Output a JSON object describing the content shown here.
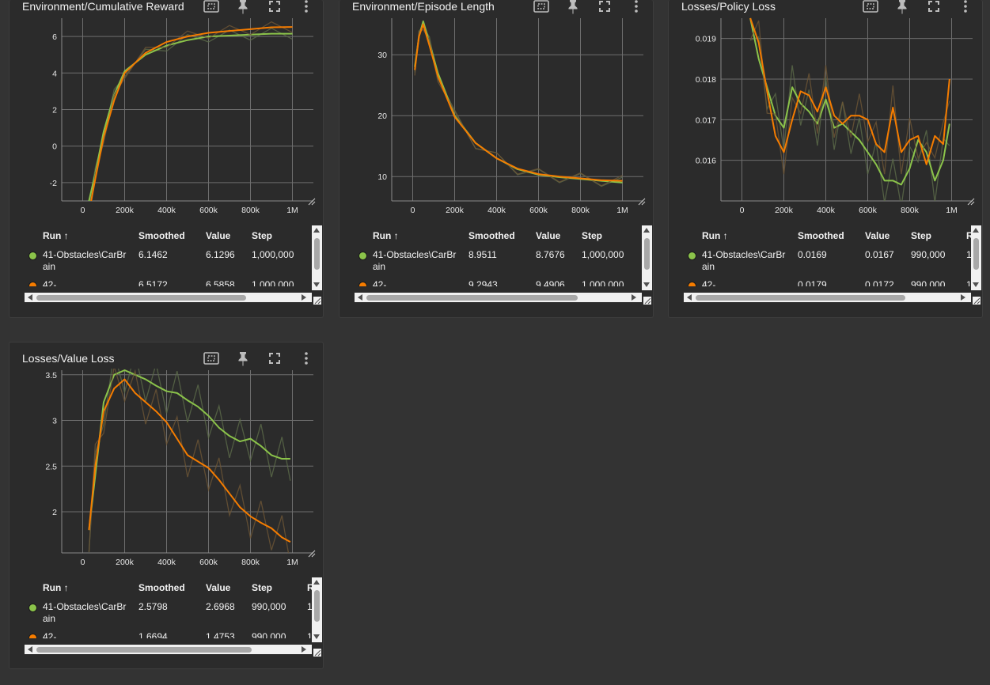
{
  "colors": {
    "green": "#8bc34a",
    "orange": "#f57c00",
    "raw_green": "#5d6b4a",
    "raw_orange": "#6e5636"
  },
  "toolbar_icons": [
    "fit-domain-icon",
    "pin-icon",
    "fullscreen-icon",
    "more-vert-icon"
  ],
  "table_headers": {
    "run": "Run ↑",
    "smoothed": "Smoothed",
    "value": "Value",
    "step": "Step",
    "relative": "R"
  },
  "cards": [
    {
      "title": "Environment/Cumulative Reward",
      "rows": [
        {
          "run": "41-Obstacles\\CarBrain",
          "smoothed": "6.1462",
          "value": "6.1296",
          "step": "1,000,000",
          "relative": ""
        },
        {
          "run": "42-",
          "smoothed": "6.5172",
          "value": "6.5858",
          "step": "1,000,000",
          "relative": ""
        }
      ]
    },
    {
      "title": "Environment/Episode Length",
      "rows": [
        {
          "run": "41-Obstacles\\CarBrain",
          "smoothed": "8.9511",
          "value": "8.7676",
          "step": "1,000,000",
          "relative": ""
        },
        {
          "run": "42-",
          "smoothed": "9.2943",
          "value": "9.4906",
          "step": "1,000,000",
          "relative": ""
        }
      ]
    },
    {
      "title": "Losses/Policy Loss",
      "rows": [
        {
          "run": "41-Obstacles\\CarBrain",
          "smoothed": "0.0169",
          "value": "0.0167",
          "step": "990,000",
          "relative": "1"
        },
        {
          "run": "42-",
          "smoothed": "0.0179",
          "value": "0.0172",
          "step": "990,000",
          "relative": "1"
        }
      ]
    },
    {
      "title": "Losses/Value Loss",
      "rows": [
        {
          "run": "41-Obstacles\\CarBrain",
          "smoothed": "2.5798",
          "value": "2.6968",
          "step": "990,000",
          "relative": "1"
        },
        {
          "run": "42-",
          "smoothed": "1.6694",
          "value": "1.4753",
          "step": "990,000",
          "relative": "1"
        }
      ]
    }
  ],
  "chart_data": [
    {
      "type": "line",
      "title": "Environment/Cumulative Reward",
      "x_ticks": [
        "0",
        "200k",
        "400k",
        "600k",
        "800k",
        "1M"
      ],
      "y_ticks": [
        "6",
        "4",
        "2",
        "0",
        "-2"
      ],
      "xlim": [
        -100000,
        1100000
      ],
      "ylim": [
        -3,
        7
      ],
      "series": [
        {
          "name": "41-Obstacles\\CarBrain",
          "color": "#8bc34a",
          "x": [
            30000,
            60000,
            100000,
            150000,
            200000,
            300000,
            400000,
            500000,
            600000,
            700000,
            800000,
            900000,
            1000000
          ],
          "y": [
            -3,
            -1.5,
            0.8,
            2.8,
            4.1,
            5.0,
            5.5,
            5.8,
            6.0,
            6.05,
            6.1,
            6.15,
            6.15
          ]
        },
        {
          "name": "42-",
          "color": "#f57c00",
          "x": [
            40000,
            60000,
            100000,
            150000,
            200000,
            300000,
            400000,
            500000,
            600000,
            700000,
            800000,
            900000,
            1000000
          ],
          "y": [
            -3,
            -1.8,
            0.5,
            2.5,
            4.0,
            5.1,
            5.7,
            6.0,
            6.2,
            6.3,
            6.4,
            6.5,
            6.52
          ]
        }
      ]
    },
    {
      "type": "line",
      "title": "Environment/Episode Length",
      "x_ticks": [
        "0",
        "200k",
        "400k",
        "600k",
        "800k",
        "1M"
      ],
      "y_ticks": [
        "30",
        "20",
        "10"
      ],
      "xlim": [
        -100000,
        1100000
      ],
      "ylim": [
        6,
        36
      ],
      "series": [
        {
          "name": "41-Obstacles\\CarBrain",
          "color": "#8bc34a",
          "x": [
            10000,
            30000,
            50000,
            80000,
            120000,
            200000,
            300000,
            400000,
            500000,
            600000,
            700000,
            800000,
            900000,
            1000000
          ],
          "y": [
            28,
            33,
            35.5,
            32,
            27,
            20,
            15.5,
            13,
            11.2,
            10.3,
            9.9,
            9.6,
            9.3,
            9.0
          ]
        },
        {
          "name": "42-",
          "color": "#f57c00",
          "x": [
            10000,
            30000,
            50000,
            80000,
            120000,
            200000,
            300000,
            400000,
            500000,
            600000,
            700000,
            800000,
            900000,
            1000000
          ],
          "y": [
            27.5,
            33,
            35,
            31.5,
            26.5,
            19.8,
            15.5,
            13,
            11.3,
            10.4,
            10.0,
            9.7,
            9.4,
            9.3
          ]
        }
      ]
    },
    {
      "type": "line",
      "title": "Losses/Policy Loss",
      "x_ticks": [
        "0",
        "200k",
        "400k",
        "600k",
        "800k",
        "1M"
      ],
      "y_ticks": [
        "0.019",
        "0.018",
        "0.017",
        "0.016"
      ],
      "xlim": [
        -100000,
        1100000
      ],
      "ylim": [
        0.015,
        0.0195
      ],
      "series": [
        {
          "name": "41-Obstacles\\CarBrain",
          "color": "#8bc34a",
          "x": [
            40000,
            80000,
            120000,
            160000,
            200000,
            240000,
            280000,
            320000,
            360000,
            400000,
            440000,
            480000,
            520000,
            560000,
            600000,
            640000,
            680000,
            720000,
            760000,
            800000,
            840000,
            880000,
            920000,
            960000,
            990000
          ],
          "y": [
            0.0195,
            0.0185,
            0.0178,
            0.0171,
            0.0168,
            0.0178,
            0.0174,
            0.0172,
            0.0169,
            0.0175,
            0.0168,
            0.0169,
            0.0167,
            0.0165,
            0.0162,
            0.0159,
            0.0155,
            0.0155,
            0.0154,
            0.0158,
            0.0165,
            0.0162,
            0.0155,
            0.016,
            0.0169
          ]
        },
        {
          "name": "42-",
          "color": "#f57c00",
          "x": [
            40000,
            80000,
            120000,
            160000,
            200000,
            240000,
            280000,
            320000,
            360000,
            400000,
            440000,
            480000,
            520000,
            560000,
            600000,
            640000,
            680000,
            720000,
            760000,
            800000,
            840000,
            880000,
            920000,
            960000,
            990000
          ],
          "y": [
            0.0195,
            0.0189,
            0.0177,
            0.0166,
            0.0162,
            0.017,
            0.0177,
            0.0176,
            0.0172,
            0.0178,
            0.0171,
            0.0169,
            0.0171,
            0.0171,
            0.017,
            0.0164,
            0.0162,
            0.0173,
            0.0162,
            0.0165,
            0.0166,
            0.0159,
            0.0166,
            0.0164,
            0.018
          ]
        }
      ]
    },
    {
      "type": "line",
      "title": "Losses/Value Loss",
      "x_ticks": [
        "0",
        "200k",
        "400k",
        "600k",
        "800k",
        "1M"
      ],
      "y_ticks": [
        "3.5",
        "3",
        "2.5",
        "2"
      ],
      "xlim": [
        -100000,
        1100000
      ],
      "ylim": [
        1.55,
        3.55
      ],
      "series": [
        {
          "name": "41-Obstacles\\CarBrain",
          "color": "#8bc34a",
          "x": [
            30000,
            60000,
            100000,
            150000,
            200000,
            250000,
            300000,
            350000,
            400000,
            450000,
            500000,
            550000,
            600000,
            650000,
            700000,
            750000,
            800000,
            850000,
            900000,
            950000,
            990000
          ],
          "y": [
            1.8,
            2.4,
            3.2,
            3.5,
            3.55,
            3.5,
            3.45,
            3.38,
            3.32,
            3.3,
            3.22,
            3.15,
            3.05,
            2.92,
            2.83,
            2.77,
            2.8,
            2.72,
            2.62,
            2.58,
            2.58
          ]
        },
        {
          "name": "42-",
          "color": "#f57c00",
          "x": [
            30000,
            60000,
            100000,
            150000,
            200000,
            250000,
            300000,
            350000,
            400000,
            450000,
            500000,
            550000,
            600000,
            650000,
            700000,
            750000,
            800000,
            850000,
            900000,
            950000,
            990000
          ],
          "y": [
            1.8,
            2.5,
            3.1,
            3.35,
            3.45,
            3.3,
            3.2,
            3.1,
            2.98,
            2.8,
            2.62,
            2.55,
            2.48,
            2.35,
            2.2,
            2.05,
            1.95,
            1.88,
            1.82,
            1.72,
            1.67
          ]
        }
      ]
    }
  ]
}
